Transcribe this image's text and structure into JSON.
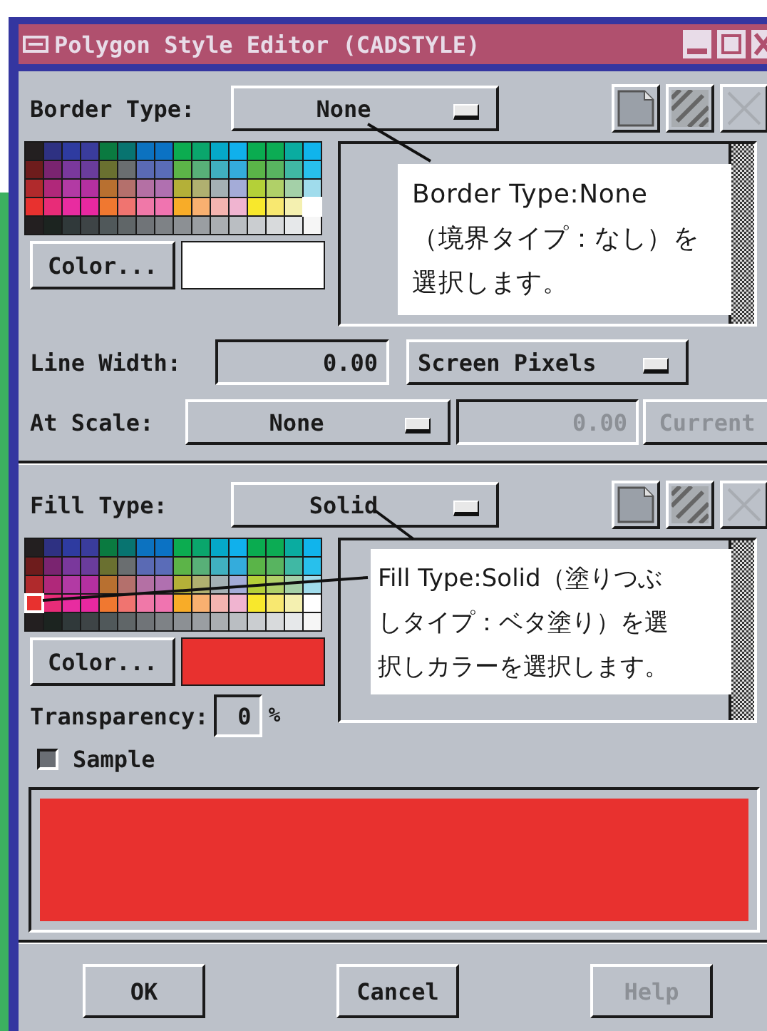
{
  "window": {
    "title": "Polygon Style Editor (CADSTYLE)"
  },
  "border": {
    "label": "Border Type:",
    "type": "None",
    "color": "#ffffff",
    "color_button": "Color...",
    "tools": [
      {
        "kind": "page",
        "disabled": false
      },
      {
        "kind": "pattern",
        "disabled": false
      },
      {
        "kind": "clear",
        "disabled": true
      }
    ],
    "callout": [
      "Border Type:None",
      "（境界タイプ：なし）を",
      "選択します。"
    ]
  },
  "line_width": {
    "label": "Line Width:",
    "value": "0.00",
    "units": "Screen Pixels"
  },
  "at_scale": {
    "label": "At Scale:",
    "value": "None",
    "scale": "0.00",
    "scale_disabled": true,
    "current_button": "Current",
    "current_disabled": true
  },
  "fill": {
    "label": "Fill Type:",
    "type": "Solid",
    "color": "#e8312f",
    "color_button": "Color...",
    "tools": [
      {
        "kind": "page",
        "disabled": false
      },
      {
        "kind": "pattern",
        "disabled": false
      },
      {
        "kind": "clear",
        "disabled": true
      }
    ],
    "transparency_label": "Transparency:",
    "transparency": "0",
    "transparency_unit": "%",
    "callout": [
      "Fill Type:Solid（塗りつぶ",
      "しタイプ：ベタ塗り）を選",
      "択しカラーを選択します。"
    ]
  },
  "sample": {
    "label": "Sample",
    "checked": true
  },
  "buttons": [
    {
      "label": "OK",
      "disabled": false
    },
    {
      "label": "Cancel",
      "disabled": false
    },
    {
      "label": "Help",
      "disabled": true
    }
  ]
}
